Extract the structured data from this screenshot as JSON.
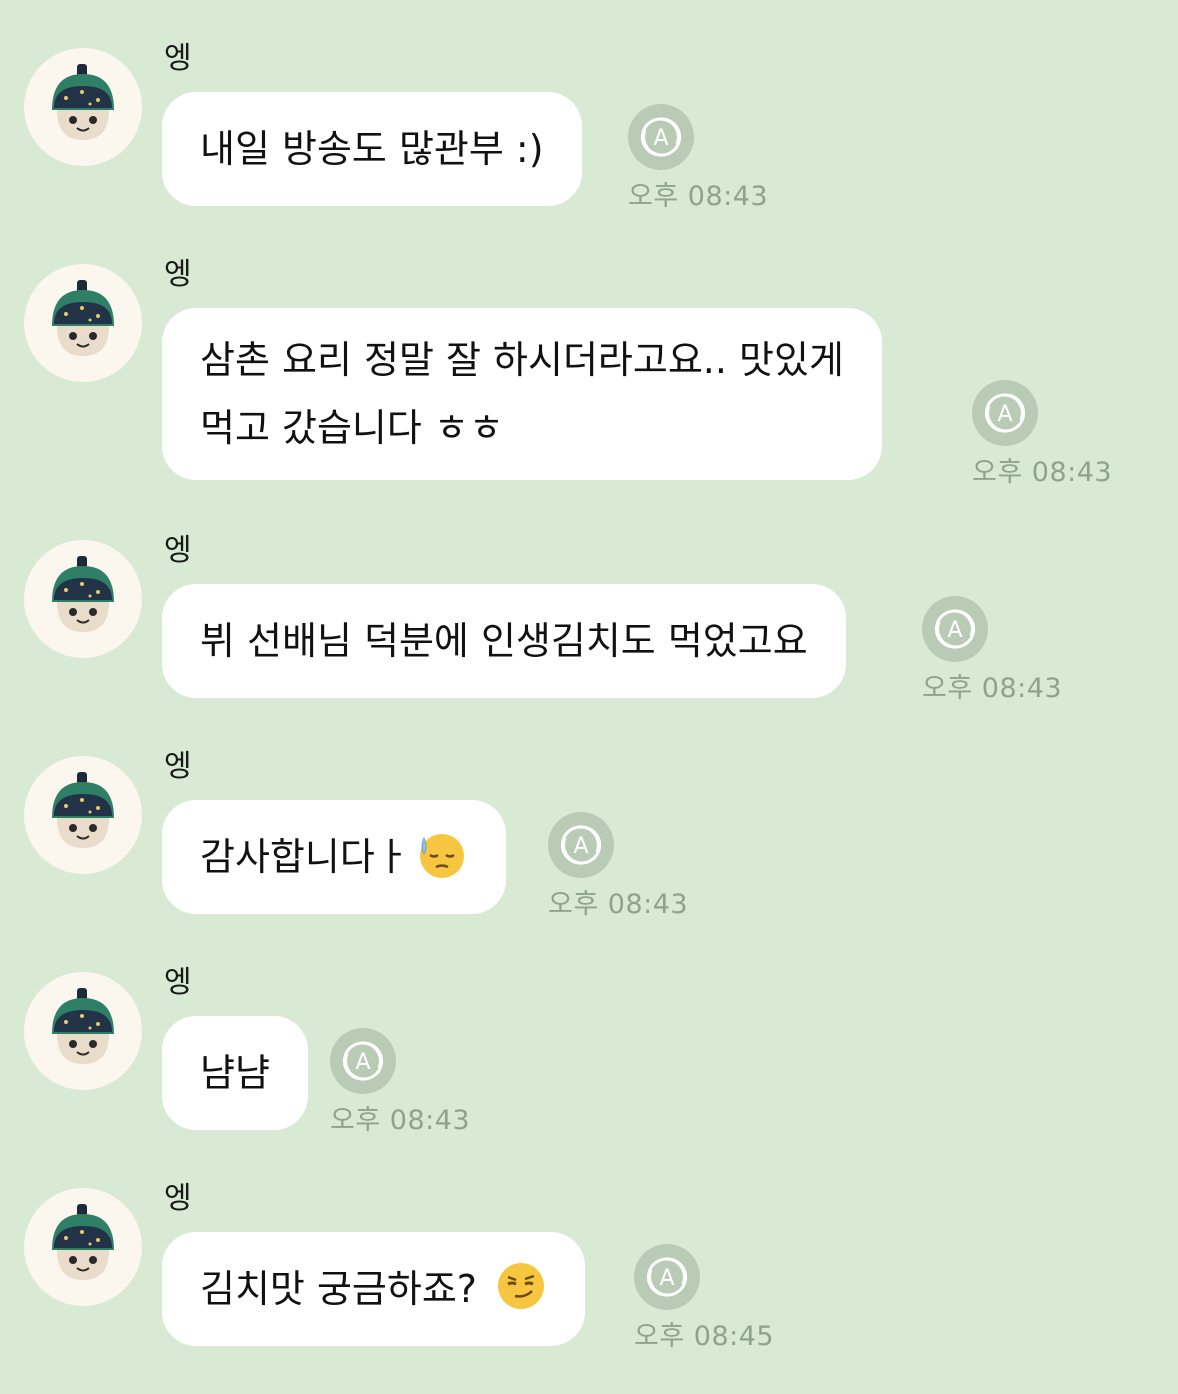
{
  "messages": [
    {
      "sender": "엥",
      "lines": [
        "내일 방송도 많관부 :)"
      ],
      "time": "오후 08:43",
      "emoji": null
    },
    {
      "sender": "엥",
      "lines": [
        "삼촌 요리 정말 잘 하시더라고요.. 맛있게",
        "먹고 갔습니다 ㅎㅎ"
      ],
      "time": "오후 08:43",
      "emoji": null
    },
    {
      "sender": "엥",
      "lines": [
        "뷔 선배님 덕분에 인생김치도 먹었고요"
      ],
      "time": "오후 08:43",
      "emoji": null
    },
    {
      "sender": "엥",
      "lines": [
        "감사합니다ㅏ"
      ],
      "time": "오후 08:43",
      "emoji": "relieved-sweat-face-emoji"
    },
    {
      "sender": "엥",
      "lines": [
        "냠냠"
      ],
      "time": "오후 08:43",
      "emoji": null
    },
    {
      "sender": "엥",
      "lines": [
        "김치맛 궁금하죠?"
      ],
      "time": "오후 08:45",
      "emoji": "smirking-face-emoji"
    }
  ],
  "icons": {
    "avatar": "mushroom-plush-avatar",
    "translate": "auto-translate-icon"
  },
  "colors": {
    "background": "#d8ead4",
    "bubble": "#ffffff",
    "translate_icon": "#b9cbb5",
    "time": "#8ea48a"
  }
}
